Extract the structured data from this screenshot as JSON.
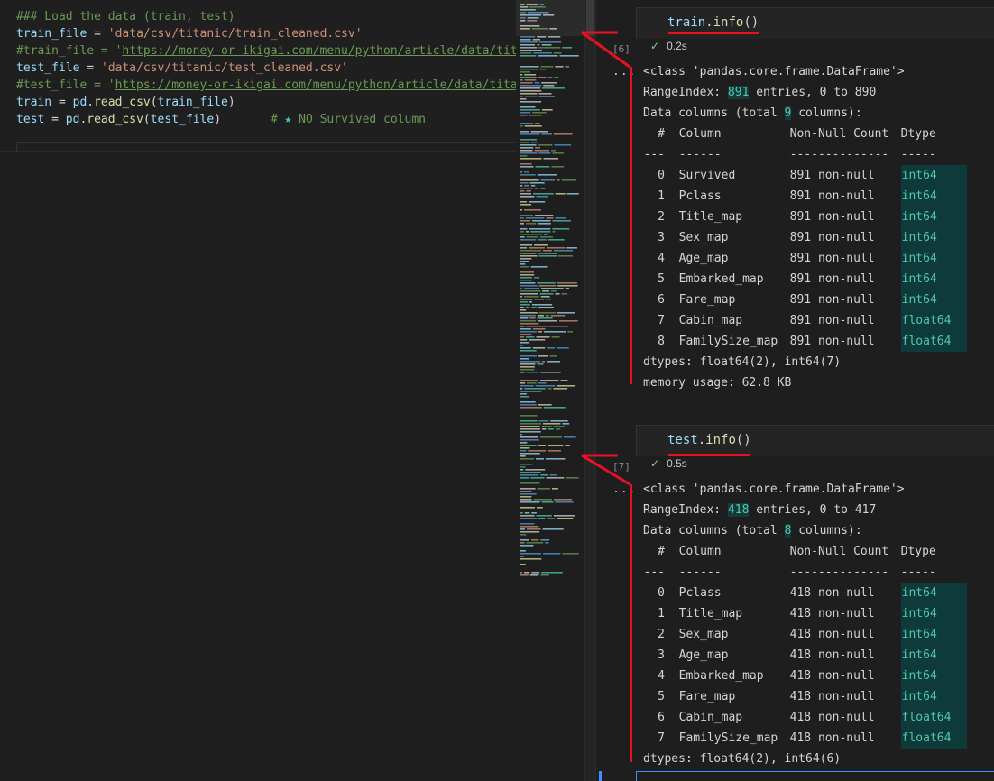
{
  "editor": {
    "lines": [
      {
        "tokens": [
          {
            "t": "### Load the data (train, test)",
            "c": "c-com"
          }
        ]
      },
      {
        "tokens": [
          {
            "t": "train_file",
            "c": "c-var"
          },
          {
            "t": " = ",
            "c": ""
          },
          {
            "t": "'data/csv/titanic/train_cleaned.csv'",
            "c": "c-str"
          }
        ]
      },
      {
        "tokens": [
          {
            "t": "#train_file = '",
            "c": "c-com"
          },
          {
            "t": "https://money-or-ikigai.com/menu/python/article/data/tita",
            "c": "c-com c-url"
          }
        ]
      },
      {
        "tokens": [
          {
            "t": "test_file",
            "c": "c-var"
          },
          {
            "t": " = ",
            "c": ""
          },
          {
            "t": "'data/csv/titanic/test_cleaned.csv'",
            "c": "c-str"
          }
        ]
      },
      {
        "tokens": [
          {
            "t": "#test_file = '",
            "c": "c-com"
          },
          {
            "t": "https://money-or-ikigai.com/menu/python/article/data/titar",
            "c": "c-com c-url"
          }
        ]
      },
      {
        "tokens": [
          {
            "t": "train",
            "c": "c-var"
          },
          {
            "t": " = ",
            "c": ""
          },
          {
            "t": "pd",
            "c": "c-var"
          },
          {
            "t": ".",
            "c": ""
          },
          {
            "t": "read_csv",
            "c": "c-fn"
          },
          {
            "t": "(",
            "c": ""
          },
          {
            "t": "train_file",
            "c": "c-var"
          },
          {
            "t": ")",
            "c": ""
          }
        ]
      },
      {
        "tokens": [
          {
            "t": "test",
            "c": "c-var"
          },
          {
            "t": " = ",
            "c": ""
          },
          {
            "t": "pd",
            "c": "c-var"
          },
          {
            "t": ".",
            "c": ""
          },
          {
            "t": "read_csv",
            "c": "c-fn"
          },
          {
            "t": "(",
            "c": ""
          },
          {
            "t": "test_file",
            "c": "c-var"
          },
          {
            "t": ")       ",
            "c": ""
          },
          {
            "t": "# ",
            "c": "c-com"
          },
          {
            "t": "★",
            "c": "c-star"
          },
          {
            "t": " NO Survived column",
            "c": "c-com"
          }
        ]
      }
    ]
  },
  "cells": [
    {
      "code_obj": "train",
      "code_fn": "info",
      "code_tail": "()",
      "exec_count": "[6]",
      "status": "0.2s",
      "ellipsis": "...",
      "class_line": "<class 'pandas.core.frame.DataFrame'>",
      "range_pre": "RangeIndex: ",
      "range_num": "891",
      "range_post": " entries, 0 to 890",
      "cols_pre": "Data columns (total ",
      "cols_num": "9",
      "cols_post": " columns):",
      "header": {
        "idx": "#",
        "col": "Column",
        "nn": "Non-Null Count",
        "dt": "Dtype"
      },
      "divider": {
        "idx": "---",
        "col": "------",
        "nn": "--------------",
        "dt": "-----"
      },
      "rows": [
        {
          "i": "0",
          "col": "Survived",
          "nn": "891 non-null",
          "dt": "int64"
        },
        {
          "i": "1",
          "col": "Pclass",
          "nn": "891 non-null",
          "dt": "int64"
        },
        {
          "i": "2",
          "col": "Title_map",
          "nn": "891 non-null",
          "dt": "int64"
        },
        {
          "i": "3",
          "col": "Sex_map",
          "nn": "891 non-null",
          "dt": "int64"
        },
        {
          "i": "4",
          "col": "Age_map",
          "nn": "891 non-null",
          "dt": "int64"
        },
        {
          "i": "5",
          "col": "Embarked_map",
          "nn": "891 non-null",
          "dt": "int64"
        },
        {
          "i": "6",
          "col": "Fare_map",
          "nn": "891 non-null",
          "dt": "int64"
        },
        {
          "i": "7",
          "col": "Cabin_map",
          "nn": "891 non-null",
          "dt": "float64"
        },
        {
          "i": "8",
          "col": "FamilySize_map",
          "nn": "891 non-null",
          "dt": "float64"
        }
      ],
      "dtypes_line": "dtypes: float64(2), int64(7)",
      "memory_line": "memory usage: 62.8 KB"
    },
    {
      "code_obj": "test",
      "code_fn": "info",
      "code_tail": "()",
      "exec_count": "[7]",
      "status": "0.5s",
      "ellipsis": "...",
      "class_line": "<class 'pandas.core.frame.DataFrame'>",
      "range_pre": "RangeIndex: ",
      "range_num": "418",
      "range_post": " entries, 0 to 417",
      "cols_pre": "Data columns (total ",
      "cols_num": "8",
      "cols_post": " columns):",
      "header": {
        "idx": "#",
        "col": "Column",
        "nn": "Non-Null Count",
        "dt": "Dtype"
      },
      "divider": {
        "idx": "---",
        "col": "------",
        "nn": "--------------",
        "dt": "-----"
      },
      "rows": [
        {
          "i": "0",
          "col": "Pclass",
          "nn": "418 non-null",
          "dt": "int64"
        },
        {
          "i": "1",
          "col": "Title_map",
          "nn": "418 non-null",
          "dt": "int64"
        },
        {
          "i": "2",
          "col": "Sex_map",
          "nn": "418 non-null",
          "dt": "int64"
        },
        {
          "i": "3",
          "col": "Age_map",
          "nn": "418 non-null",
          "dt": "int64"
        },
        {
          "i": "4",
          "col": "Embarked_map",
          "nn": "418 non-null",
          "dt": "int64"
        },
        {
          "i": "5",
          "col": "Fare_map",
          "nn": "418 non-null",
          "dt": "int64"
        },
        {
          "i": "6",
          "col": "Cabin_map",
          "nn": "418 non-null",
          "dt": "float64"
        },
        {
          "i": "7",
          "col": "FamilySize_map",
          "nn": "418 non-null",
          "dt": "float64"
        }
      ],
      "dtypes_line": "dtypes: float64(2), int64(6)",
      "memory_line": ""
    }
  ],
  "colors": {
    "annotation": "#e81123",
    "accent": "#3794ff",
    "highlight": "#4ec9b0"
  }
}
